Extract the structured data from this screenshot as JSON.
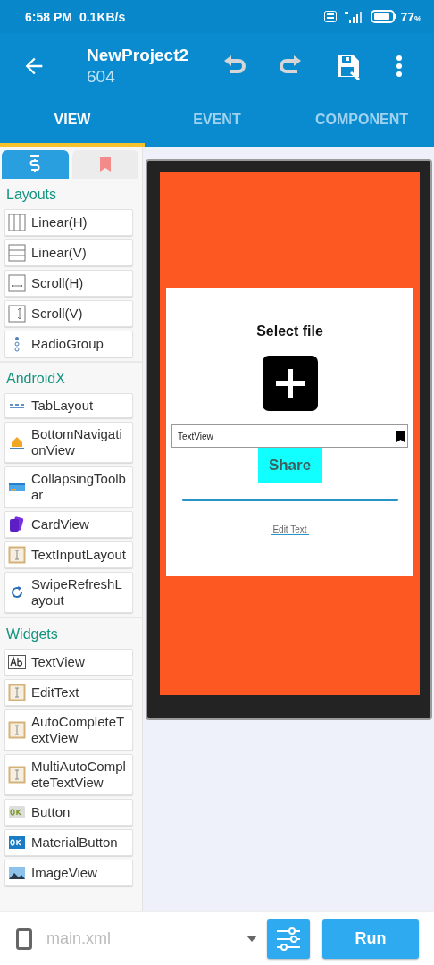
{
  "status_bar": {
    "time": "6:58 PM",
    "speed": "0.1KB/s",
    "battery": "77",
    "battery_unit": "%"
  },
  "app_bar": {
    "title": "NewProject2",
    "subtitle": "604"
  },
  "tabs": [
    {
      "label": "VIEW",
      "selected": true
    },
    {
      "label": "EVENT",
      "selected": false
    },
    {
      "label": "COMPONENT",
      "selected": false
    }
  ],
  "palette_tabs": [
    {
      "kind": "widgets",
      "selected": true
    },
    {
      "kind": "bookmarks",
      "selected": false
    }
  ],
  "palette": [
    {
      "title": "Layouts",
      "items": [
        {
          "label": "Linear(H)",
          "kind": "linear-h"
        },
        {
          "label": "Linear(V)",
          "kind": "linear-v"
        },
        {
          "label": "Scroll(H)",
          "kind": "scroll-h"
        },
        {
          "label": "Scroll(V)",
          "kind": "scroll-v"
        },
        {
          "label": "RadioGroup",
          "kind": "radio"
        }
      ]
    },
    {
      "title": "AndroidX",
      "items": [
        {
          "label": "TabLayout",
          "kind": "tab"
        },
        {
          "label": "BottomNavigationView",
          "kind": "bottomnav"
        },
        {
          "label": "CollapsingToolbar",
          "kind": "toolbar"
        },
        {
          "label": "CardView",
          "kind": "card"
        },
        {
          "label": "TextInputLayout",
          "kind": "textinput"
        },
        {
          "label": "SwipeRefreshLayout",
          "kind": "refresh"
        }
      ]
    },
    {
      "title": "Widgets",
      "items": [
        {
          "label": "TextView",
          "kind": "textview"
        },
        {
          "label": "EditText",
          "kind": "edittext"
        },
        {
          "label": "AutoCompleteTextView",
          "kind": "edittext"
        },
        {
          "label": "MultiAutoCompleteTextView",
          "kind": "edittext"
        },
        {
          "label": "Button",
          "kind": "button"
        },
        {
          "label": "MaterialButton",
          "kind": "materialbutton"
        },
        {
          "label": "ImageView",
          "kind": "image"
        }
      ]
    }
  ],
  "preview": {
    "title": "Select file",
    "text_view": "TextView",
    "button": "Share",
    "edit_text": "Edit Text"
  },
  "bottom_bar": {
    "file": "main.xml",
    "run": "Run"
  }
}
